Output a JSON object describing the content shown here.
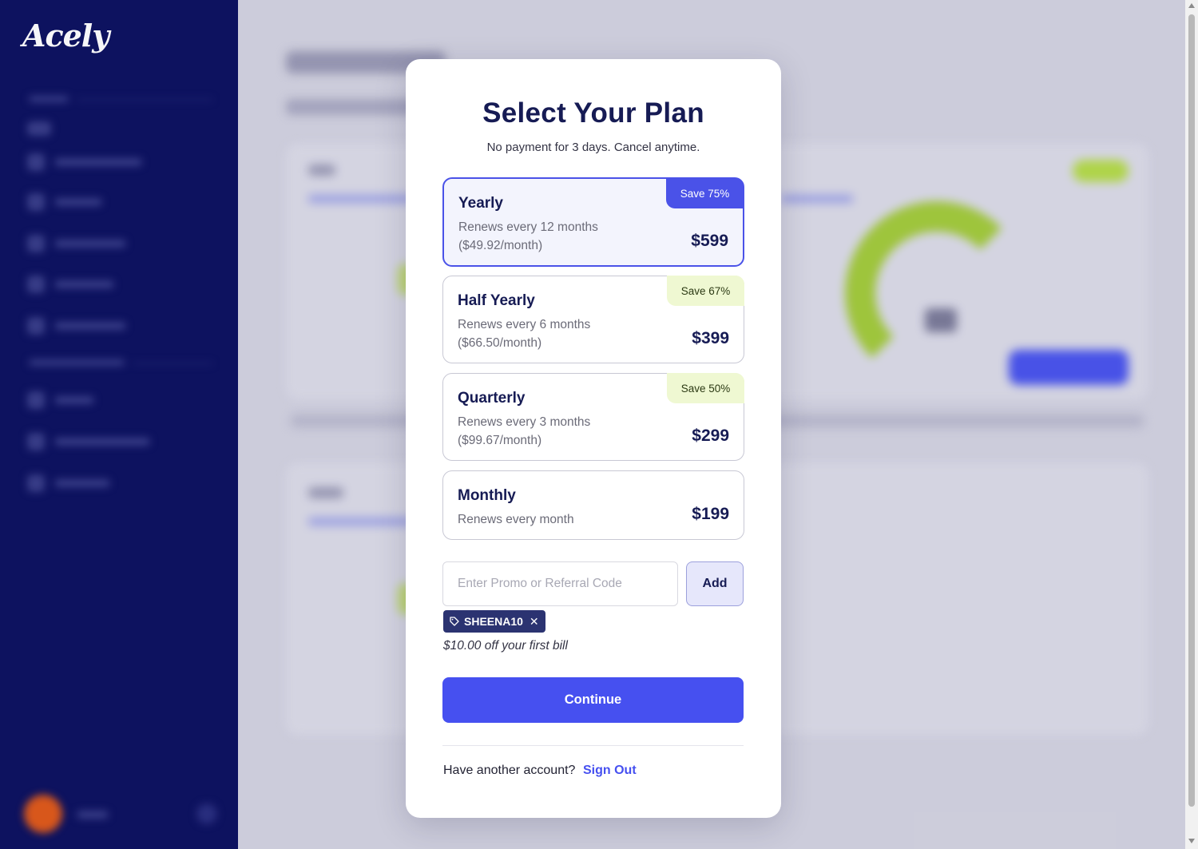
{
  "app": {
    "logo_text": "Acely"
  },
  "modal": {
    "title": "Select Your Plan",
    "subtitle": "No payment for 3 days. Cancel anytime.",
    "plans": [
      {
        "name": "Yearly",
        "renews": "Renews every 12 months",
        "per_month": "($49.92/month)",
        "price": "$599",
        "badge": "Save 75%",
        "selected": true
      },
      {
        "name": "Half Yearly",
        "renews": "Renews every 6 months",
        "per_month": "($66.50/month)",
        "price": "$399",
        "badge": "Save 67%",
        "selected": false
      },
      {
        "name": "Quarterly",
        "renews": "Renews every 3 months",
        "per_month": "($99.67/month)",
        "price": "$299",
        "badge": "Save 50%",
        "selected": false
      },
      {
        "name": "Monthly",
        "renews": "Renews every month",
        "price": "$199",
        "selected": false
      }
    ],
    "promo": {
      "placeholder": "Enter Promo or Referral Code",
      "value": "",
      "add_label": "Add",
      "applied_code": "SHEENA10",
      "remove_glyph": "✕",
      "discount_text": "$10.00 off your first bill"
    },
    "continue_label": "Continue",
    "account_prompt": "Have another account?",
    "sign_out_label": "Sign Out"
  },
  "colors": {
    "accent": "#4650f0",
    "sidebar": "#0d1260",
    "badge_selected": "#4a52e8",
    "badge_other": "#eff8d2",
    "promo_tag": "#2b3371"
  },
  "icons": [
    "tag-icon",
    "close-icon"
  ]
}
